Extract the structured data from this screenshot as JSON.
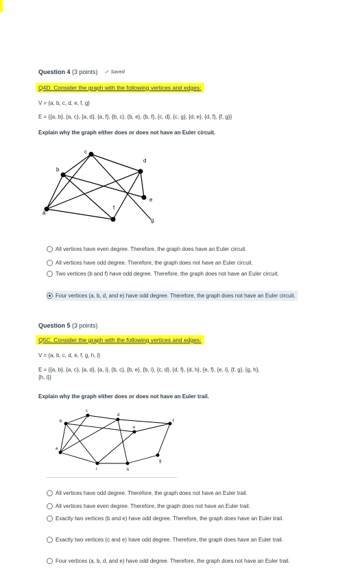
{
  "q4": {
    "title": "Question 4",
    "points": "(3 points)",
    "saved": "Saved",
    "prompt": "Q4D. Consider the graph with the following vertices and edges:",
    "vertices": "V = {a, b, c, d, e, f, g}",
    "edges": "E = {{a, b}, {a, c}, {a, d}, {a, f}, {b, c}, {b, e}, {b, f}, {c, d}, {c, g}, {d, e}, {d, f}, {f, g}}",
    "question": "Explain why the graph either does or does not have an Euler circuit.",
    "graph_labels": [
      "a",
      "b",
      "c",
      "d",
      "e",
      "f",
      "g"
    ],
    "options": [
      "All vertices have even degree. Therefore, the graph does have an Euler circuit.",
      "All vertices have odd degree. Therefore, the graph does not have an Euler circuit.",
      "Two vertices (b and f) have odd degree. Therefore, the graph does not have an Euler circuit.",
      "Four vertices (a, b, d, and e) have odd degree. Therefore, the graph does not have an Euler circuit."
    ],
    "selected_index": 3
  },
  "q5": {
    "title": "Question 5",
    "points": "(3 points)",
    "prompt": "Q5C. Consider the graph with the following vertices and edges:",
    "vertices": "V = {a, b, c, d, e, f, g, h, i}",
    "edges_line1": "E = {{a, b}, {a, c}, {a, d}, {a, i}, {b, c}, {b, e}, {b, i}, {c, d}, {d, f}, {d, h}, {e, f}, {e, i}, {f, g}, {g, h},",
    "edges_line2": "{h, i}}",
    "question": "Explain why the graph either does or does not have an Euler trail.",
    "graph_labels": [
      "a",
      "b",
      "c",
      "d",
      "e",
      "f",
      "g",
      "h",
      "i"
    ],
    "options": [
      "All vertices have odd degree. Therefore, the graph does not have an Euler trail.",
      "All vertices have even degree. Therefore, the graph does not have an Euler trail.",
      "Exactly two vertices (b and e) have odd degree. Therefore, the graph does have an Euler trail.",
      "Exactly two vertices (c and e) have odd degree. Therefore, the graph does have an Euler trail.",
      "Four vertices (a, b, d, and e) have odd degree. Therefore, the graph does not have an Euler trail."
    ]
  }
}
